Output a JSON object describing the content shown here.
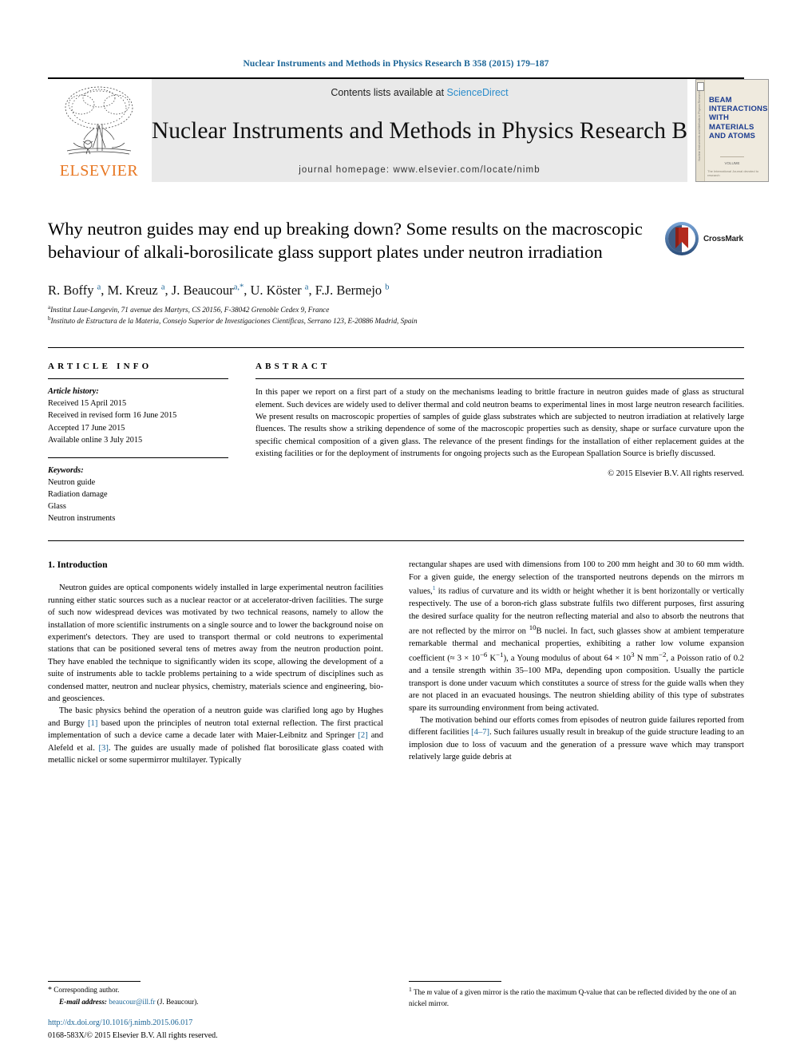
{
  "running_head": "Nuclear Instruments and Methods in Physics Research B 358 (2015) 179–187",
  "masthead": {
    "contents_prefix": "Contents lists available at ",
    "sciencedirect": "ScienceDirect",
    "journal_title": "Nuclear Instruments and Methods in Physics Research B",
    "homepage": "journal homepage: www.elsevier.com/locate/nimb",
    "publisher": "ELSEVIER",
    "cover": {
      "line1": "BEAM",
      "line2": "INTERACTIONS",
      "line3": "WITH",
      "line4": "MATERIALS",
      "line5": "AND ATOMS",
      "volume": "VOLUME",
      "spine": "Nuclear Instruments and Methods in Physics Research",
      "footer": "The International Journal devoted to research"
    }
  },
  "title": "Why neutron guides may end up breaking down? Some results on the macroscopic behaviour of alkali-borosilicate glass support plates under neutron irradiation",
  "crossmark_label": "CrossMark",
  "authors_html": "R. Boffy <sup>a</sup>, M. Kreuz <sup>a</sup>, J. Beaucour<sup>a,*</sup>, U. Köster <sup>a</sup>, F.J. Bermejo <sup>b</sup>",
  "affiliations": [
    {
      "marker": "a",
      "text": "Institut Laue-Langevin, 71 avenue des Martyrs, CS 20156, F-38042 Grenoble Cedex 9, France"
    },
    {
      "marker": "b",
      "text": "Instituto de Estructura de la Materia, Consejo Superior de Investigaciones Científicas, Serrano 123, E-20886 Madrid, Spain"
    }
  ],
  "article_info": {
    "heading": "ARTICLE INFO",
    "history_label": "Article history:",
    "history": [
      "Received 15 April 2015",
      "Received in revised form 16 June 2015",
      "Accepted 17 June 2015",
      "Available online 3 July 2015"
    ],
    "keywords_label": "Keywords:",
    "keywords": [
      "Neutron guide",
      "Radiation damage",
      "Glass",
      "Neutron instruments"
    ]
  },
  "abstract": {
    "heading": "ABSTRACT",
    "text": "In this paper we report on a first part of a study on the mechanisms leading to brittle fracture in neutron guides made of glass as structural element. Such devices are widely used to deliver thermal and cold neutron beams to experimental lines in most large neutron research facilities. We present results on macroscopic properties of samples of guide glass substrates which are subjected to neutron irradiation at relatively large fluences. The results show a striking dependence of some of the macroscopic properties such as density, shape or surface curvature upon the specific chemical composition of a given glass. The relevance of the present findings for the installation of either replacement guides at the existing facilities or for the deployment of instruments for ongoing projects such as the European Spallation Source is briefly discussed.",
    "copyright": "© 2015 Elsevier B.V. All rights reserved."
  },
  "body": {
    "section_title": "1. Introduction",
    "left_p1": "Neutron guides are optical components widely installed in large experimental neutron facilities running either static sources such as a nuclear reactor or at accelerator-driven facilities. The surge of such now widespread devices was motivated by two technical reasons, namely to allow the installation of more scientific instruments on a single source and to lower the background noise on experiment's detectors. They are used to transport thermal or cold neutrons to experimental stations that can be positioned several tens of metres away from the neutron production point. They have enabled the technique to significantly widen its scope, allowing the development of a suite of instruments able to tackle problems pertaining to a wide spectrum of disciplines such as condensed matter, neutron and nuclear physics, chemistry, materials science and engineering, bio- and geosciences.",
    "left_p2_html": "The basic physics behind the operation of a neutron guide was clarified long ago by Hughes and Burgy <span class=\"ref\">[1]</span> based upon the principles of neutron total external reflection. The first practical implementation of such a device came a decade later with Maier-Leibnitz and Springer <span class=\"ref\">[2]</span> and Alefeld et al. <span class=\"ref\">[3]</span>. The guides are usually made of polished flat borosilicate glass coated with metallic nickel or some supermirror multilayer. Typically",
    "right_p1_html": "rectangular shapes are used with dimensions from 100 to 200 mm height and 30 to 60 mm width. For a given guide, the energy selection of the transported neutrons depends on the mirrors m values,<sup class=\"fn\">1</sup> its radius of curvature and its width or height whether it is bent horizontally or vertically respectively. The use of a boron-rich glass substrate fulfils two different purposes, first assuring the desired surface quality for the neutron reflecting material and also to absorb the neutrons that are not reflected by the mirror on <sup>10</sup>B nuclei. In fact, such glasses show at ambient temperature remarkable thermal and mechanical properties, exhibiting a rather low volume expansion coefficient (&#8776; 3 &times; 10<sup>&#8722;6</sup> K<sup>&#8722;1</sup>), a Young modulus of about 64 &times; 10<sup>3</sup> N mm<sup>&#8722;2</sup>, a Poisson ratio of 0.2 and a tensile strength within 35–100 MPa, depending upon composition. Usually the particle transport is done under vacuum which constitutes a source of stress for the guide walls when they are not placed in an evacuated housings. The neutron shielding ability of this type of substrates spare its surrounding environment from being activated.",
    "right_p2_html": "The motivation behind our efforts comes from episodes of neutron guide failures reported from different facilities <span class=\"ref\">[4–7]</span>. Such failures usually result in breakup of the guide structure leading to an implosion due to loss of vacuum and the generation of a pressure wave which may transport relatively large guide debris at"
  },
  "footnotes": {
    "corresponding": "Corresponding author.",
    "email_label": "E-mail address:",
    "email": "beaucour@ill.fr",
    "email_suffix": "(J. Beaucour).",
    "doi": "http://dx.doi.org/10.1016/j.nimb.2015.06.017",
    "issn": "0168-583X/© 2015 Elsevier B.V. All rights reserved.",
    "right_marker": "1",
    "right_text_html": "The <span class=\"it\">m</span> value of a given mirror is the ratio the maximum Q-value that can be reflected divided by the one of an nickel mirror."
  }
}
